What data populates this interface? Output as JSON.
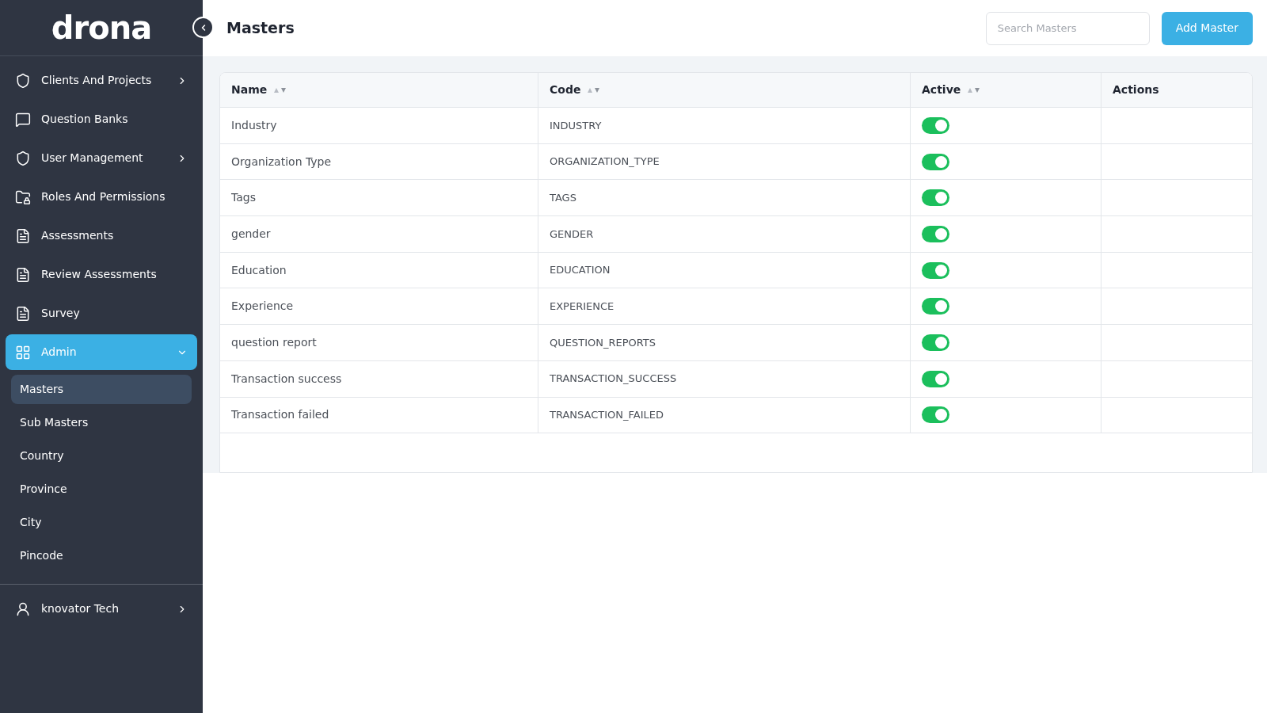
{
  "logo": "drona",
  "sidebar": {
    "items": [
      {
        "label": "Clients And Projects",
        "kind": "collapsed",
        "selected": false
      },
      {
        "label": "Question Banks",
        "kind": "link",
        "selected": false
      },
      {
        "label": "User Management",
        "kind": "collapsed",
        "selected": false
      },
      {
        "label": "Roles And Permissions",
        "kind": "link",
        "selected": false
      },
      {
        "label": "Assessments",
        "kind": "link",
        "selected": false
      },
      {
        "label": "Review Assessments",
        "kind": "link",
        "selected": false
      },
      {
        "label": "Survey",
        "kind": "link",
        "selected": false
      },
      {
        "label": "Admin",
        "kind": "expanded",
        "selected": true,
        "children": [
          {
            "label": "Masters",
            "selected": true
          },
          {
            "label": "Sub Masters",
            "selected": false
          },
          {
            "label": "Country",
            "selected": false
          },
          {
            "label": "Province",
            "selected": false
          },
          {
            "label": "City",
            "selected": false
          },
          {
            "label": "Pincode",
            "selected": false
          }
        ]
      }
    ],
    "user": {
      "label": "knovator Tech"
    }
  },
  "header": {
    "title": "Masters",
    "search": {
      "placeholder": "Search Masters"
    },
    "button": "Add Master"
  },
  "table": {
    "columns": [
      {
        "label": "Name",
        "sortable": true
      },
      {
        "label": "Code",
        "sortable": true
      },
      {
        "label": "Active",
        "sortable": true
      },
      {
        "label": "Actions",
        "sortable": false
      }
    ],
    "rows": [
      {
        "name": "Industry",
        "code": "INDUSTRY",
        "on": true
      },
      {
        "name": "Organization Type",
        "code": "ORGANIZATION_TYPE",
        "on": true
      },
      {
        "name": "Tags",
        "code": "TAGS",
        "on": true
      },
      {
        "name": "gender",
        "code": "GENDER",
        "on": true
      },
      {
        "name": "Education",
        "code": "EDUCATION",
        "on": true
      },
      {
        "name": "Experience",
        "code": "EXPERIENCE",
        "on": true
      },
      {
        "name": "question report",
        "code": "QUESTION_REPORTS",
        "on": true
      },
      {
        "name": "Transaction success",
        "code": "TRANSACTION_SUCCESS",
        "on": true
      },
      {
        "name": "Transaction failed",
        "code": "TRANSACTION_FAILED",
        "on": true
      }
    ]
  }
}
